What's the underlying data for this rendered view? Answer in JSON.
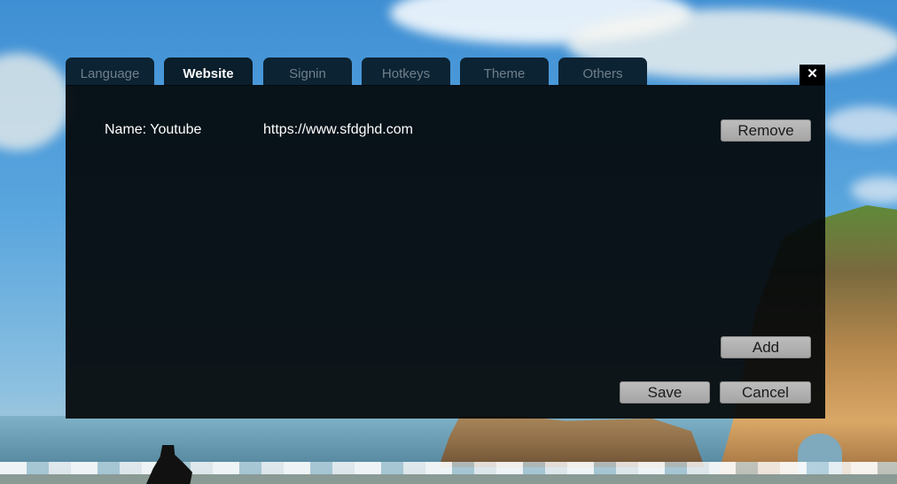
{
  "dialog": {
    "tabs": [
      {
        "label": "Language"
      },
      {
        "label": "Website"
      },
      {
        "label": "Signin"
      },
      {
        "label": "Hotkeys"
      },
      {
        "label": "Theme"
      },
      {
        "label": "Others"
      }
    ],
    "active_tab": "Website",
    "close_label": "✕"
  },
  "website": {
    "entries": [
      {
        "name": "Name: Youtube",
        "url": "https://www.sfdghd.com",
        "remove_label": "Remove"
      }
    ],
    "add_label": "Add"
  },
  "footer": {
    "save_label": "Save",
    "cancel_label": "Cancel"
  },
  "colors": {
    "tab_bg": "#0c2333",
    "panel_bg": "#03080a",
    "button_bg": "#b0b0b0"
  }
}
